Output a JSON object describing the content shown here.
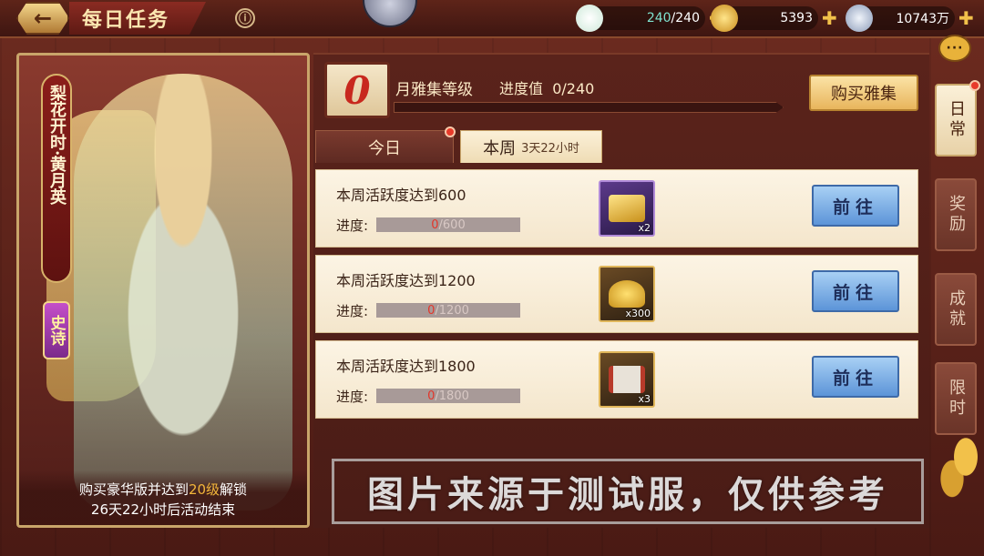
{
  "header": {
    "title": "每日任务",
    "info_icon": "ⓘ"
  },
  "resources": [
    {
      "name": "stamina",
      "icon": "bun-icon",
      "current": "240",
      "max": "/240",
      "color": "#7fe3d0"
    },
    {
      "name": "gold",
      "icon": "ingot-icon",
      "value": "5393"
    },
    {
      "name": "coin",
      "icon": "coin-icon",
      "value": "10743万"
    }
  ],
  "hero": {
    "name": "梨花开时·黄月英",
    "rarity": "史诗",
    "unlock_prefix": "购买豪华版并达到",
    "unlock_level": "20级",
    "unlock_suffix": "解锁",
    "countdown": "26天22小时后活动结束"
  },
  "level": {
    "value": "0",
    "label": "月雅集等级",
    "progress_label": "进度值",
    "progress_text": "0/240",
    "progress_fraction": 0
  },
  "buy_button": "购买雅集",
  "tabs": {
    "today": "今日",
    "week": "本周",
    "week_timer": "3天22小时"
  },
  "tasks": [
    {
      "title": "本周活跃度达到600",
      "progress_label": "进度:",
      "current": "0",
      "total": "/600",
      "reward_icon": "gold-bar-icon",
      "reward_qty": "x2",
      "go_label": "前往"
    },
    {
      "title": "本周活跃度达到1200",
      "progress_label": "进度:",
      "current": "0",
      "total": "/1200",
      "reward_icon": "ingot-icon",
      "reward_qty": "x300",
      "go_label": "前往"
    },
    {
      "title": "本周活跃度达到1800",
      "progress_label": "进度:",
      "current": "0",
      "total": "/1800",
      "reward_icon": "scroll-icon",
      "reward_qty": "x3",
      "go_label": "前往"
    }
  ],
  "side_tabs": [
    {
      "label": "日常",
      "active": true
    },
    {
      "label": "奖励",
      "active": false
    },
    {
      "label": "成就",
      "active": false
    },
    {
      "label": "限时",
      "active": false
    }
  ],
  "chat_icon": "···",
  "watermark": "图片来源于测试服，仅供参考",
  "colors": {
    "accent_red": "#e3362a",
    "button_gold": "#e8b55c",
    "button_blue": "#5c94d8"
  }
}
